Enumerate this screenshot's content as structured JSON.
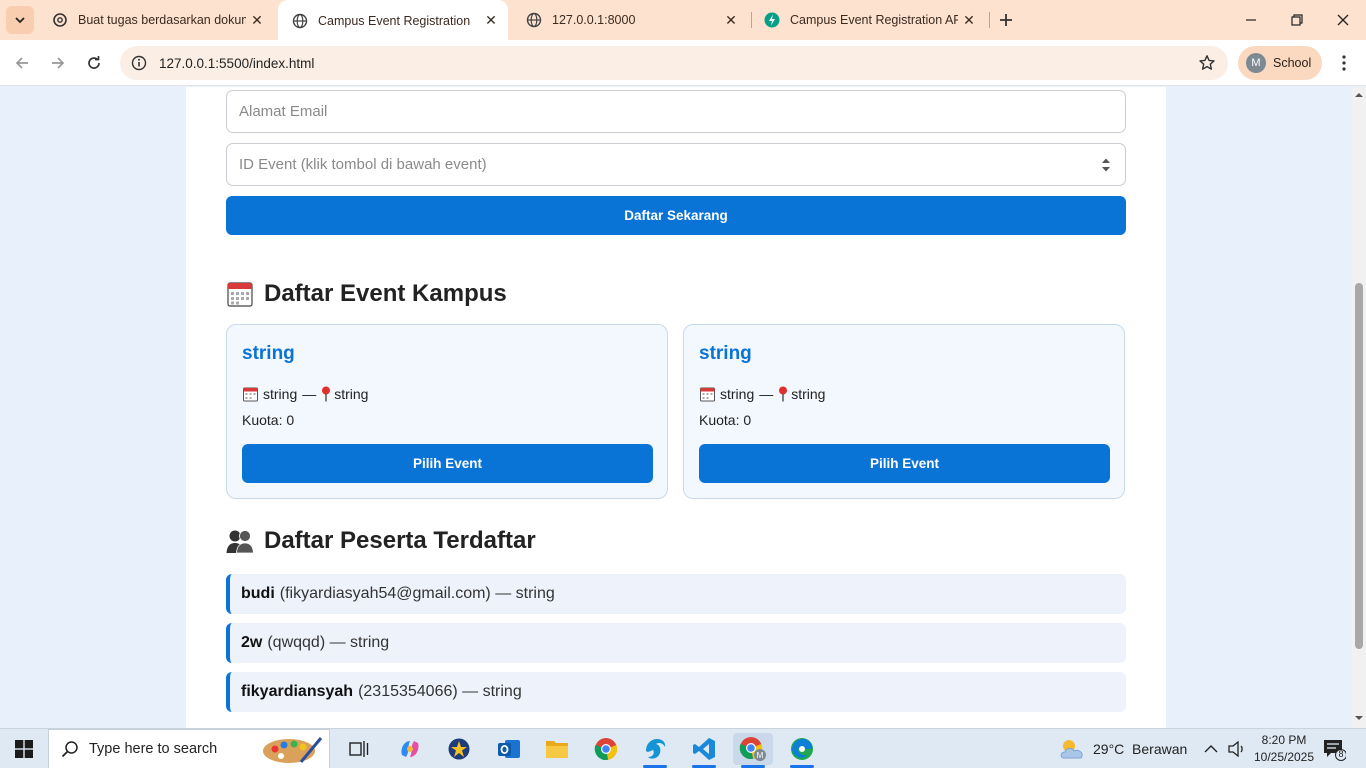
{
  "browser": {
    "tabs": [
      {
        "title": "Buat tugas berdasarkan dokume",
        "icon": "openai-icon",
        "active": false
      },
      {
        "title": "Campus Event Registration",
        "icon": "globe-icon",
        "active": true
      },
      {
        "title": "127.0.0.1:8000",
        "icon": "globe-icon",
        "active": false
      },
      {
        "title": "Campus Event Registration API",
        "icon": "fastapi-icon",
        "active": false
      }
    ],
    "url": "127.0.0.1:5500/index.html",
    "profile_initial": "M",
    "profile_name": "School"
  },
  "form": {
    "email_placeholder": "Alamat Email",
    "event_id_placeholder": "ID Event (klik tombol di bawah event)",
    "submit_label": "Daftar Sekarang"
  },
  "events_section": {
    "title": "Daftar Event Kampus",
    "events": [
      {
        "name": "string",
        "date": "string",
        "separator": "—",
        "location": "string",
        "quota": "Kuota: 0",
        "button": "Pilih Event"
      },
      {
        "name": "string",
        "date": "string",
        "separator": "—",
        "location": "string",
        "quota": "Kuota: 0",
        "button": "Pilih Event"
      }
    ]
  },
  "participants_section": {
    "title": "Daftar Peserta Terdaftar",
    "participants": [
      {
        "name": "budi",
        "detail": "(fikyardiasyah54@gmail.com) — string"
      },
      {
        "name": "2w",
        "detail": "(qwqqd) — string"
      },
      {
        "name": "fikyardiansyah",
        "detail": "(2315354066) — string"
      }
    ]
  },
  "taskbar": {
    "search_placeholder": "Type here to search",
    "weather": "29°C  Berawan",
    "time": "8:20 PM",
    "date": "10/25/2025",
    "notification_count": "8"
  },
  "colors": {
    "accent": "#0a73d6",
    "tabbar": "#fde3cf",
    "page_bg": "#e8f1fb"
  }
}
